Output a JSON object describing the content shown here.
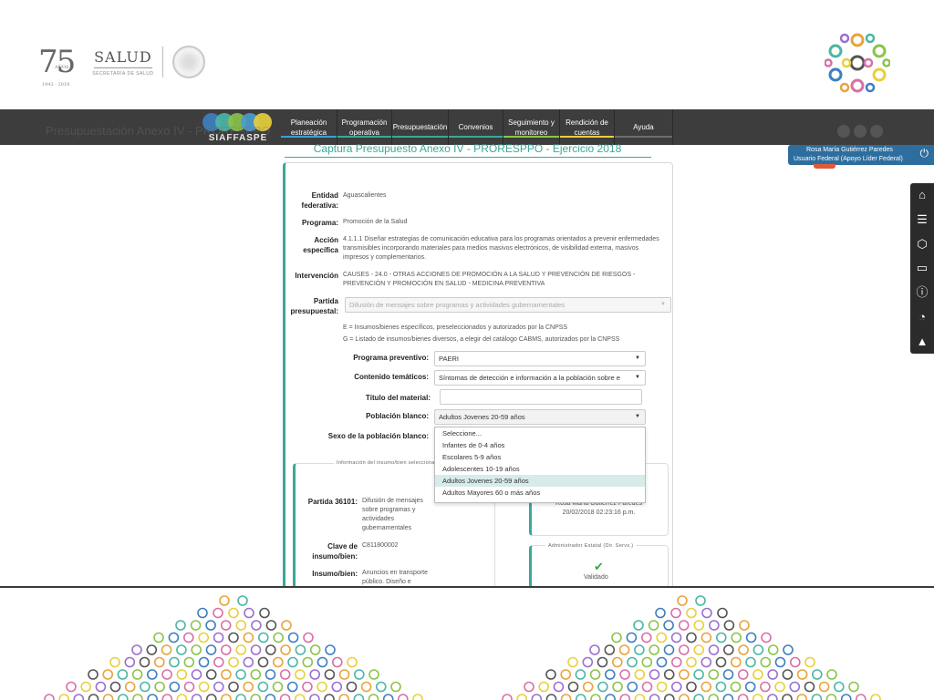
{
  "header": {
    "anniversary_number": "75",
    "anniversary_anos": "AÑOS",
    "anniversary_years": "1943 - 2018",
    "salud_title": "SALUD",
    "salud_subtitle": "SECRETARÍA DE SALUD",
    "seal_icon": "mexico-seal-icon",
    "flower_icon": "colorful-rings-logo-icon"
  },
  "brand": {
    "name": "SIAFFASPE",
    "colors": [
      "#3d7fbf",
      "#4bb6a6",
      "#8bc34a",
      "#e8d03c"
    ]
  },
  "nav": {
    "items": [
      {
        "label": "Planeación estratégica",
        "width": 62,
        "bar": "#3aa0d8"
      },
      {
        "label": "Programación operativa",
        "width": 60,
        "bar": "#3aa89a"
      },
      {
        "label": "Presupuestación",
        "width": 62,
        "bar": "#3aa89a"
      },
      {
        "label": "Convenios",
        "width": 60,
        "bar": "#3aa89a"
      },
      {
        "label": "Seguimiento y monitoreo",
        "width": 62,
        "bar": "#8bc34a"
      },
      {
        "label": "Rendición de cuentas",
        "width": 60,
        "bar": "#e8d03c"
      },
      {
        "label": "Ayuda",
        "width": 64,
        "bar": "#6d6d6d"
      }
    ]
  },
  "ghost_title": "Presupuestación Anexo IV - PRORESPPO",
  "user": {
    "name": "Rosa María Gutiérrez Paredes",
    "role": "Usuario Federal (Apoyo Líder Federal)",
    "power_icon": "power-icon"
  },
  "side_icons": [
    "home-icon",
    "list-icon",
    "cube-icon",
    "card-icon",
    "info-icon",
    "chart-icon",
    "graduation-cap-icon"
  ],
  "form": {
    "heading": "Captura Presupuesto Anexo IV - PRORESPPO - Ejercicio 2018",
    "entidad_label": "Entidad federativa:",
    "entidad_value": "Aguascalientes",
    "programa_label": "Programa:",
    "programa_value": "Promoción de la Salud",
    "accion_label": "Acción específica",
    "accion_value": "4.1.1.1 Diseñar estrategias de comunicación educativa para los programas orientados a prevenir enfermedades transmisibles incorporando materiales para medios masivos electrónicos, de visibilidad externa, masivos impresos y complementarios.",
    "intervencion_label": "Intervención",
    "intervencion_value": "CAUSES - 24.0 - OTRAS ACCIONES DE PROMOCIÓN A LA SALUD Y PREVENCIÓN DE RIESGOS - PREVENCIÓN Y PROMOCIÓN EN SALUD - MEDICINA PREVENTIVA",
    "partida_label": "Partida presupuestal:",
    "partida_value": "Difusión de mensajes sobre programas y actividades gubernamentales",
    "note_e": "E = Insumos/bienes específicos, preseleccionados y autorizados por la CNPSS",
    "note_g": "G = Listado de insumos/bienes diversos, a elegir del catálogo CABMS, autorizados por la CNPSS",
    "programa_prev_label": "Programa preventivo:",
    "programa_prev_value": "PAERI",
    "contenido_label": "Contenido temáticos:",
    "contenido_value": "Síntomas de detección e información a la población sobre e",
    "titulo_label": "Título del material:",
    "poblacion_label": "Población blanco:",
    "poblacion_value": "Adultos Jovenes 20-59 años",
    "sexo_label": "Sexo de la población blanco:"
  },
  "dropdown": {
    "options": [
      "Seleccione...",
      "Infantes de 0-4 años",
      "Escolares 5-9 años",
      "Adolescentes 10-19 años",
      "Adultos Jovenes 20-59 años",
      "Adultos Mayores 60 o más años"
    ],
    "selected_index": 4
  },
  "insumo": {
    "section_title": "Información del insumo/bien seleccionado",
    "partida_label": "Partida 36101:",
    "partida_value": "Difusión de mensajes sobre programas y actividades gubernamentales",
    "clave_label": "Clave de insumo/bien:",
    "clave_value": "C811800002",
    "insumo_label": "Insumo/bien:",
    "insumo_value": "Anuncios en transporte público. Diseño e"
  },
  "right_panel": {
    "captured_by": "Rosa María Gutiérrez Paredes",
    "captured_at": "20/02/2018 02:23:16 p.m.",
    "admin_title": "Administrador Estatal (Dir. Servs.)",
    "check_icon": "checkmark-icon",
    "status": "Validado"
  }
}
